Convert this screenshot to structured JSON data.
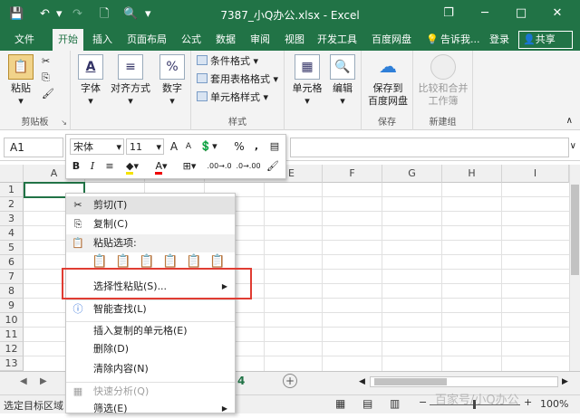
{
  "window": {
    "title": "7387_小Q办公.xlsx - Excel",
    "minimize_glyph": "─",
    "restore_glyph": "❐",
    "maximize_glyph": "□",
    "close_glyph": "✕"
  },
  "qat": {
    "save": "💾",
    "undo": "↶",
    "redo": "↷",
    "new": "🗋",
    "preview": "🔍",
    "more": "▾"
  },
  "tabs": [
    "文件",
    "开始",
    "插入",
    "页面布局",
    "公式",
    "数据",
    "审阅",
    "视图",
    "开发工具",
    "百度网盘"
  ],
  "tabs_right": {
    "tell_me": "告诉我...",
    "login": "登录",
    "share": "共享"
  },
  "ribbon": {
    "clipboard": {
      "paste": "粘贴",
      "group": "剪贴板"
    },
    "font": "字体",
    "align": "对齐方式",
    "number": "数字",
    "styles": {
      "cond": "条件格式",
      "table": "套用表格格式",
      "cell": "单元格样式",
      "group": "样式"
    },
    "cells": "单元格",
    "edit": "编辑",
    "save": {
      "line1": "保存到",
      "line2": "百度网盘",
      "group": "保存"
    },
    "compare": {
      "line1": "比较和合并",
      "line2": "工作簿",
      "group": "新建组"
    }
  },
  "namebox": "A1",
  "mini_toolbar": {
    "font_name": "宋体",
    "font_size": "11",
    "grow": "A",
    "shrink": "A",
    "percent": "%",
    "comma": ",",
    "bold": "B",
    "italic": "I",
    "font_color": "A",
    "inc_decimal": ".00→.0",
    "dec_decimal": ".0→.00"
  },
  "columns": [
    "A",
    "B",
    "C",
    "D",
    "E",
    "F",
    "G",
    "H",
    "I"
  ],
  "rows": [
    "1",
    "2",
    "3",
    "4",
    "5",
    "6",
    "7",
    "8",
    "9",
    "10",
    "11",
    "12",
    "13"
  ],
  "context_menu": {
    "cut": "剪切(T)",
    "copy": "复制(C)",
    "paste_options": "粘贴选项:",
    "paste_special": "选择性粘贴(S)...",
    "smart_lookup": "智能查找(L)",
    "insert_copied": "插入复制的单元格(E)",
    "delete": "删除(D)",
    "clear": "清除内容(N)",
    "quick_analysis": "快速分析(Q)",
    "filter": "筛选(E)"
  },
  "sheetbar": {
    "sheet_partial": "4",
    "add": "+"
  },
  "statusbar": {
    "message": "选定目标区域",
    "zoom": "100%",
    "watermark": "百家号/小Q办公"
  },
  "colors": {
    "accent": "#217346",
    "highlight": "#e03c32"
  }
}
